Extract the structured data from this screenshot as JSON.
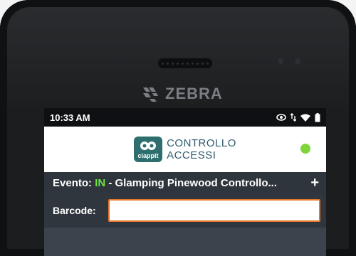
{
  "device": {
    "brand": "ZEBRA",
    "logo_icon": "zebra-stripes-icon"
  },
  "statusbar": {
    "time": "10:33 AM",
    "icons": [
      "eye-icon",
      "data-arrows-icon",
      "wifi-icon",
      "battery-icon"
    ]
  },
  "app": {
    "logo_text": "ciappit",
    "title_line1": "CONTROLLO",
    "title_line2": "ACCESSI",
    "status_color": "#7fd63a",
    "brand_color": "#2e6e6e"
  },
  "event": {
    "prefix": "Evento: ",
    "direction": "IN",
    "name": " - Glamping Pinewood Controllo...",
    "add_label": "+"
  },
  "barcode": {
    "label": "Barcode:",
    "value": "",
    "placeholder": ""
  }
}
